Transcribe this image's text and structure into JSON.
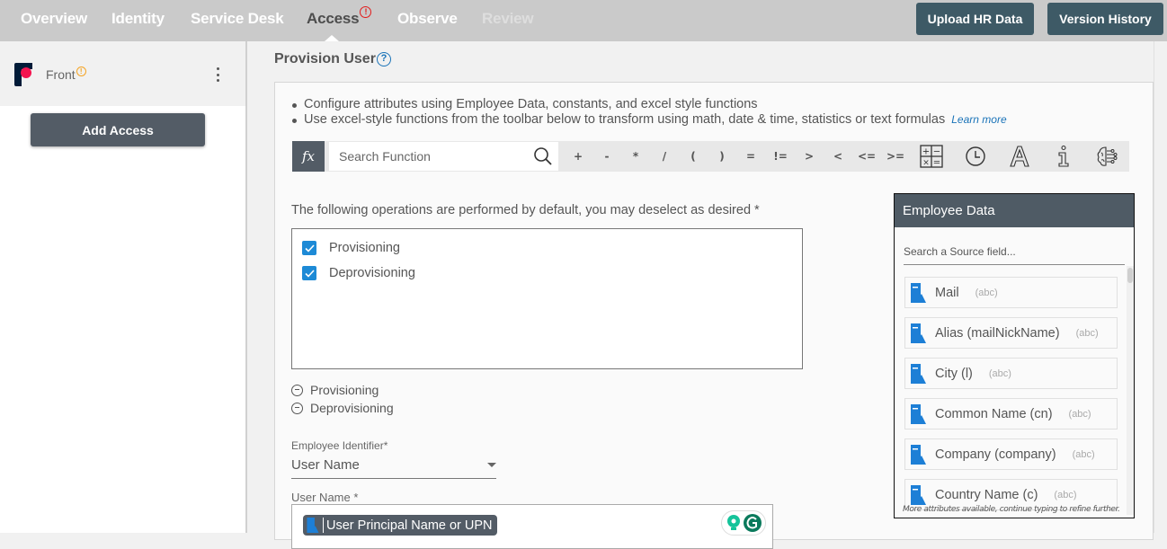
{
  "topnav": {
    "items": [
      {
        "label": "Overview",
        "state": "normal"
      },
      {
        "label": "Identity",
        "state": "normal"
      },
      {
        "label": "Service Desk",
        "state": "normal"
      },
      {
        "label": "Access",
        "state": "active",
        "badge": "!"
      },
      {
        "label": "Observe",
        "state": "normal"
      },
      {
        "label": "Review",
        "state": "disabled"
      }
    ],
    "buttons": {
      "upload_hr_data": "Upload HR Data",
      "version_history": "Version History"
    }
  },
  "sidebar": {
    "app_name": "Front",
    "app_warning": "!",
    "add_access_label": "Add Access"
  },
  "main": {
    "title": "Provision User",
    "help": "?",
    "instructions": [
      "Configure attributes using Employee Data, constants, and excel style functions",
      "Use excel-style functions from the toolbar below to transform using math, date & time, statistics or text formulas"
    ],
    "learn_more": "Learn more",
    "toolbar": {
      "fx_label": "fx",
      "search_placeholder": "Search Function",
      "operators": [
        "+",
        "-",
        "*",
        "/",
        "(",
        ")",
        "=",
        "!=",
        ">",
        "<",
        "<=",
        ">="
      ],
      "icons": [
        "math-functions-icon",
        "clock-icon",
        "text-icon",
        "info-icon",
        "ai-brain-icon"
      ]
    },
    "operations": {
      "label": "The following operations are performed by default, you may deselect as desired *",
      "options": [
        {
          "label": "Provisioning",
          "checked": true
        },
        {
          "label": "Deprovisioning",
          "checked": true
        }
      ],
      "summary": [
        "Provisioning",
        "Deprovisioning"
      ]
    },
    "employee_identifier": {
      "label": "Employee Identifier*",
      "value": "User Name"
    },
    "user_name": {
      "label": "User Name *",
      "chip": "User Principal Name or UPN"
    }
  },
  "employee_data": {
    "title": "Employee Data",
    "search_placeholder": "Search a Source field...",
    "fields": [
      {
        "name": "Mail",
        "type": "(abc)"
      },
      {
        "name": "Alias (mailNickName)",
        "type": "(abc)"
      },
      {
        "name": "City (l)",
        "type": "(abc)"
      },
      {
        "name": "Common Name (cn)",
        "type": "(abc)"
      },
      {
        "name": "Company (company)",
        "type": "(abc)"
      },
      {
        "name": "Country Name (c)",
        "type": "(abc)"
      }
    ],
    "footer": "More attributes available, continue typing to refine further."
  },
  "colors": {
    "accent_blue": "#1d8ad6",
    "dark_button": "#3e5a66",
    "panel_header": "#4f5b65",
    "alert_red": "#e31b1b",
    "warning_orange": "#f4a424"
  }
}
